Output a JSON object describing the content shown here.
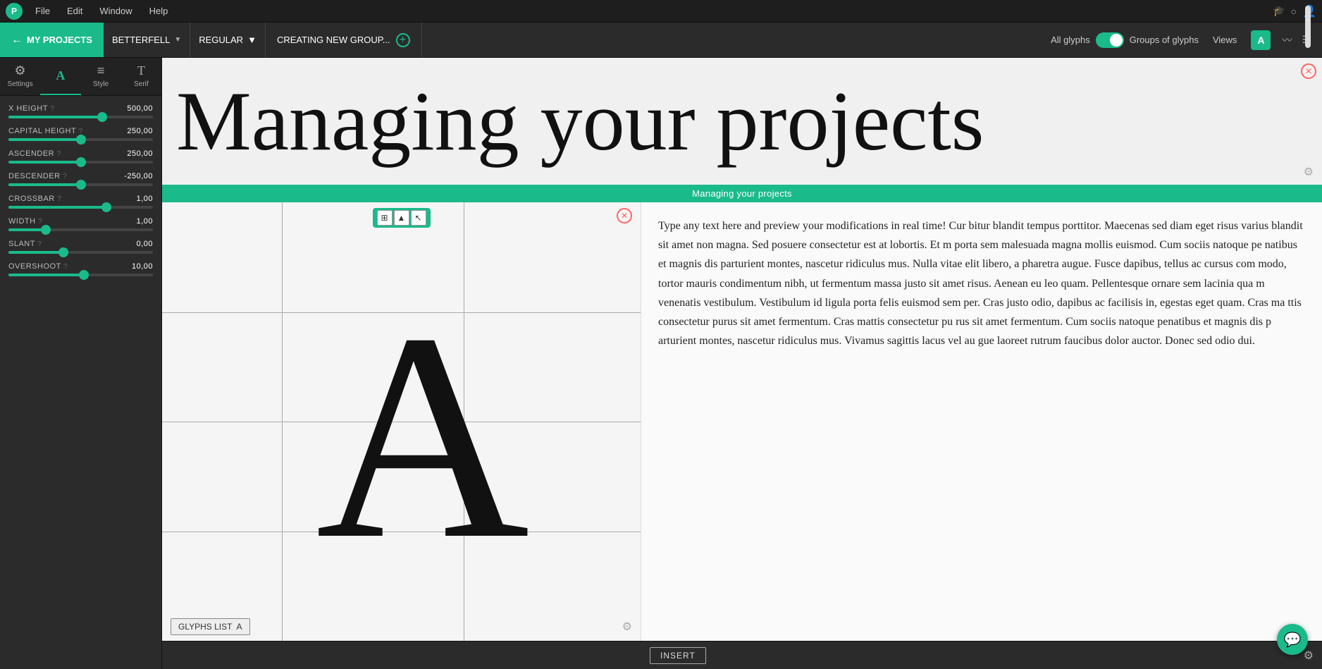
{
  "app": {
    "logo": "P",
    "menu": [
      "File",
      "Edit",
      "Window",
      "Help"
    ]
  },
  "toolbar": {
    "project_label": "MY PROJECTS",
    "font_name": "BETTERFELL",
    "style_name": "REGULAR",
    "new_group_label": "CREATING NEW GROUP...",
    "all_glyphs_label": "All glyphs",
    "groups_label": "Groups of glyphs",
    "views_label": "Views",
    "glyph_key": "A"
  },
  "sidebar": {
    "tabs": [
      {
        "id": "settings",
        "label": "Settings",
        "icon": "⚙"
      },
      {
        "id": "glyphs",
        "label": "",
        "icon": "A",
        "active": true
      },
      {
        "id": "style",
        "label": "Style",
        "icon": "≡"
      },
      {
        "id": "serif",
        "label": "Serif",
        "icon": "T"
      }
    ],
    "controls": [
      {
        "id": "x-height",
        "label": "X HEIGHT",
        "value": "500,00",
        "percent": 65
      },
      {
        "id": "capital-height",
        "label": "CAPITAL HEIGHT",
        "value": "250,00",
        "percent": 50
      },
      {
        "id": "ascender",
        "label": "ASCENDER",
        "value": "250,00",
        "percent": 50
      },
      {
        "id": "descender",
        "label": "DESCENDER",
        "value": "-250,00",
        "percent": 50
      },
      {
        "id": "crossbar",
        "label": "CROSSBAR",
        "value": "1,00",
        "percent": 68
      },
      {
        "id": "width",
        "label": "WIDTH",
        "value": "1,00",
        "percent": 26
      },
      {
        "id": "slant",
        "label": "SLANT",
        "value": "0,00",
        "percent": 38
      },
      {
        "id": "overshoot",
        "label": "OVERSHOOT",
        "value": "10,00",
        "percent": 52
      }
    ]
  },
  "preview_banner": {
    "text": "Managing your projects"
  },
  "subtitle_bar": {
    "text": "Managing your projects"
  },
  "glyph_editor": {
    "letter": "A",
    "tools": [
      "⊞",
      "▲",
      "↖"
    ],
    "footer_label": "GLYPHS LIST",
    "footer_glyph": "A"
  },
  "text_preview": {
    "content": "Type any text here and preview your modifications in real time! Cur bitur blandit tempus porttitor. Maecenas sed diam eget risus varius blandit sit amet non magna. Sed posuere consectetur est at lobortis. Et m porta sem malesuada magna mollis euismod. Cum sociis natoque pe natibus et magnis dis parturient montes, nascetur ridiculus mus. Nulla vitae elit libero, a pharetra augue. Fusce dapibus, tellus ac cursus com modo, tortor mauris condimentum nibh, ut fermentum massa justo sit amet risus. Aenean eu leo quam. Pellentesque ornare sem lacinia qua m venenatis vestibulum. Vestibulum id ligula porta felis euismod sem per. Cras justo odio, dapibus ac facilisis in, egestas eget quam. Cras ma ttis consectetur purus sit amet fermentum. Cras mattis consectetur pu rus sit amet fermentum. Cum sociis natoque penatibus et magnis dis p arturient montes, nascetur ridiculus mus. Vivamus sagittis lacus vel au gue laoreet rutrum faucibus dolor auctor. Donec sed odio dui."
  },
  "insert_bar": {
    "button_label": "INSERT"
  }
}
